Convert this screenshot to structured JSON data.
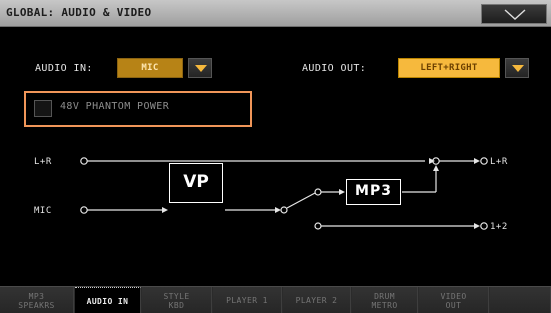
{
  "window": {
    "title": "GLOBAL: AUDIO & VIDEO"
  },
  "audio_in": {
    "label": "AUDIO IN:",
    "value": "MIC"
  },
  "audio_out": {
    "label": "AUDIO OUT:",
    "value": "LEFT+RIGHT"
  },
  "phantom_power": {
    "label": "48V PHANTOM POWER",
    "checked": false
  },
  "diagram": {
    "input_lr": "L+R",
    "input_mic": "MIC",
    "vp_block": "VP",
    "mp3_block": "MP3",
    "output_lr": "L+R",
    "output_12": "1+2"
  },
  "tabs": [
    {
      "label": "MP3\nSPEAKRS",
      "active": false
    },
    {
      "label": "AUDIO IN",
      "active": true
    },
    {
      "label": "STYLE\nKBD",
      "active": false
    },
    {
      "label": "PLAYER 1",
      "active": false
    },
    {
      "label": "PLAYER 2",
      "active": false
    },
    {
      "label": "DRUM\nMETRO",
      "active": false
    },
    {
      "label": "VIDEO\nOUT",
      "active": false
    }
  ],
  "colors": {
    "accent_orange": "#f6b93d",
    "highlight_frame": "#f09659",
    "titlebar": "#b3b3b3"
  },
  "icons": [
    "chevron-down-icon",
    "dropdown-arrow-icon",
    "checkbox"
  ]
}
